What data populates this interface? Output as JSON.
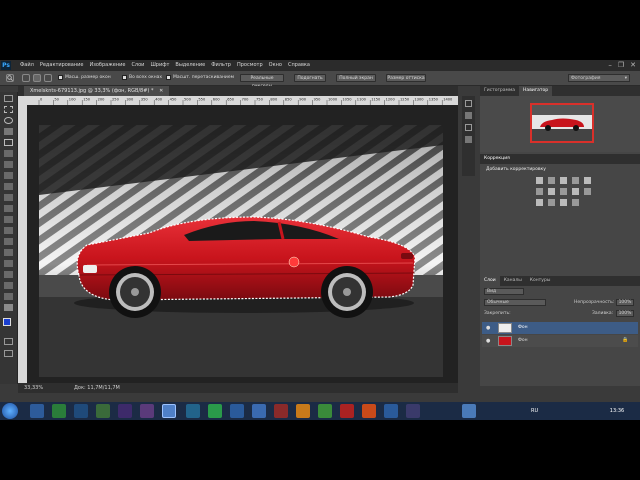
{
  "app": {
    "logo": "Ps"
  },
  "menu": [
    "Файл",
    "Редактирование",
    "Изображение",
    "Слои",
    "Шрифт",
    "Выделение",
    "Фильтр",
    "Просмотр",
    "Окно",
    "Справка"
  ],
  "window_buttons": {
    "minimize": "–",
    "restore": "❐",
    "close": "✕"
  },
  "options_bar": {
    "sample_all_label": "Масш. размер окон",
    "all_windows_label": "Во всех окнах",
    "scrubby_label": "Масшт. перетаскиванием",
    "actual_pixels": "Реальные пикселы",
    "fit_screen": "Подогнать",
    "fill_screen": "Полный экран",
    "print_size": "Размер оттиска",
    "workspace": "Фотография"
  },
  "document": {
    "tab_title": "Xmelsknts-679113.jpg @ 33,3% (фон, RGB/8#) *",
    "zoom": "33,33%",
    "doc_size": "Док: 11,7М/11,7М",
    "ruler_ticks": [
      "0",
      "50",
      "100",
      "150",
      "200",
      "250",
      "300",
      "350",
      "400",
      "450",
      "500",
      "550",
      "600",
      "650",
      "700",
      "750",
      "800",
      "850",
      "900",
      "950",
      "1000",
      "1050",
      "1100",
      "1150",
      "1200",
      "1250",
      "1300",
      "1350",
      "1400"
    ]
  },
  "panels": {
    "nav_tabs": [
      "Гистограмма",
      "Навигатор"
    ],
    "adjustments_title": "Коррекция",
    "adjustments_add": "Добавить корректировку",
    "layer_tabs": [
      "Слои",
      "Каналы",
      "Контуры"
    ],
    "kind_label": "Вид",
    "blend_mode": "Обычные",
    "opacity_label": "Непрозрачность:",
    "opacity_value": "100%",
    "lock_label": "Закрепить:",
    "fill_label": "Заливка:",
    "fill_value": "100%",
    "layers": [
      {
        "name": "Фон",
        "selected": true
      },
      {
        "name": "Фон",
        "selected": false
      }
    ]
  },
  "taskbar": {
    "lang": "RU",
    "time": "13:36"
  },
  "colors": {
    "accent": "#3a6fc4",
    "car_red": "#c8141c"
  }
}
